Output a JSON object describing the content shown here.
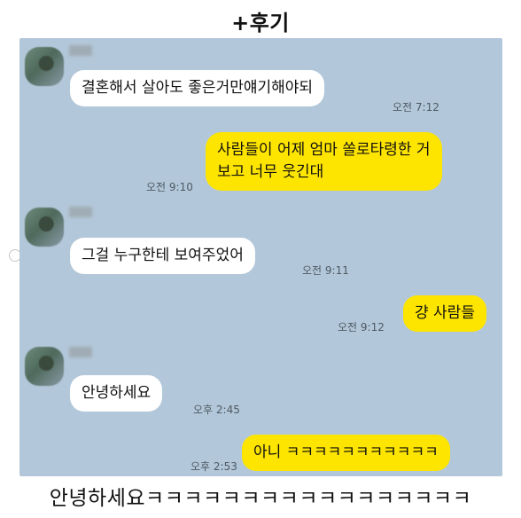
{
  "caption_top": "+후기",
  "caption_bottom": "안녕하세요ㅋㅋㅋㅋㅋㅋㅋㅋㅋㅋㅋㅋㅋㅋㅋㅋㅋ",
  "messages": [
    {
      "side": "in",
      "text": "결혼해서 살아도  좋은거만얘기해야되",
      "time": "오전 7:12"
    },
    {
      "side": "out",
      "lines": [
        "사람들이 어제 엄마 쏠로타령한 거",
        "보고 너무 웃긴대"
      ],
      "time": "오전 9:10"
    },
    {
      "side": "in",
      "text": "그걸 누구한테 보여주었어",
      "time": "오전 9:11"
    },
    {
      "side": "out",
      "text": "걍 사람들",
      "time": "오전 9:12"
    },
    {
      "side": "in",
      "text": "안녕하세요",
      "time": "오후 2:45"
    },
    {
      "side": "out",
      "text": "아니 ㅋㅋㅋㅋㅋㅋㅋㅋㅋㅋㅋ",
      "time": "오후 2:53"
    }
  ],
  "colors": {
    "chat_background": "#b2c7d9",
    "incoming_bubble": "#ffffff",
    "outgoing_bubble": "#fee500"
  }
}
